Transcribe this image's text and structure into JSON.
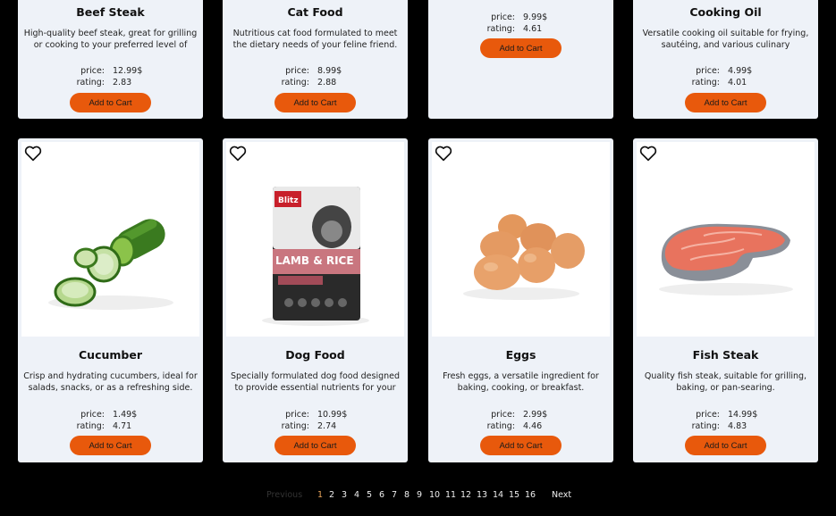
{
  "products_top": [
    {
      "name": "Beef Steak",
      "description": "High-quality beef steak, great for grilling or cooking to your preferred level of doneness.",
      "price": "12.99$",
      "rating": "2.83"
    },
    {
      "name": "Cat Food",
      "description": "Nutritious cat food formulated to meet the dietary needs of your feline friend.",
      "price": "8.99$",
      "rating": "2.88"
    },
    {
      "name": "",
      "description": "",
      "price": "9.99$",
      "rating": "4.61"
    },
    {
      "name": "Cooking Oil",
      "description": "Versatile cooking oil suitable for frying, sautéing, and various culinary applications.",
      "price": "4.99$",
      "rating": "4.01"
    }
  ],
  "products_bottom": [
    {
      "name": "Cucumber",
      "description": "Crisp and hydrating cucumbers, ideal for salads, snacks, or as a refreshing side.",
      "price": "1.49$",
      "rating": "4.71",
      "image": "cucumber"
    },
    {
      "name": "Dog Food",
      "description": "Specially formulated dog food designed to provide essential nutrients for your canine companion.",
      "price": "10.99$",
      "rating": "2.74",
      "image": "dog-food-bag",
      "bag_text": "LAMB & RICE"
    },
    {
      "name": "Eggs",
      "description": "Fresh eggs, a versatile ingredient for baking, cooking, or breakfast.",
      "price": "2.99$",
      "rating": "4.46",
      "image": "eggs"
    },
    {
      "name": "Fish Steak",
      "description": "Quality fish steak, suitable for grilling, baking, or pan-searing.",
      "price": "14.99$",
      "rating": "4.83",
      "image": "fish-steak"
    }
  ],
  "labels": {
    "price": "price:",
    "rating": "rating:",
    "add_to_cart": "Add to Cart"
  },
  "pagination": {
    "previous": "Previous",
    "next": "Next",
    "pages": [
      "1",
      "2",
      "3",
      "4",
      "5",
      "6",
      "7",
      "8",
      "9",
      "10",
      "11",
      "12",
      "13",
      "14",
      "15",
      "16"
    ],
    "current": "1"
  },
  "colors": {
    "accent": "#e8590c",
    "card_bg": "#eef2f8",
    "page_bg": "#000000"
  },
  "icons": {
    "favorite": "heart-outline-icon"
  }
}
